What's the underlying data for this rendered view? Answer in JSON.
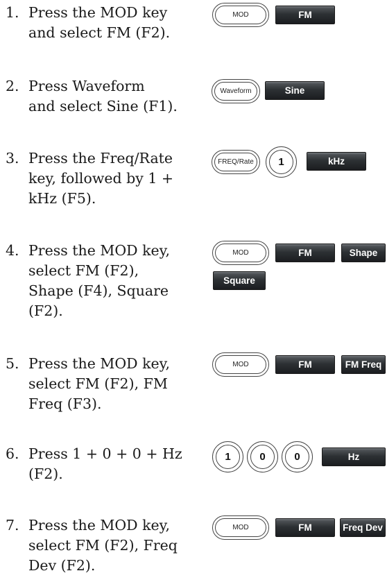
{
  "steps": [
    {
      "num": "1.",
      "text": "Press the MOD key\nand select FM (F2).",
      "keys": [
        {
          "type": "oval",
          "label": "MOD"
        },
        {
          "type": "soft",
          "label": "FM"
        }
      ]
    },
    {
      "num": "2.",
      "text": "Press Waveform\nand select Sine (F1).",
      "keys": [
        {
          "type": "oval",
          "label": "Waveform"
        },
        {
          "type": "soft",
          "label": "Sine"
        }
      ]
    },
    {
      "num": "3.",
      "text": "Press the Freq/Rate\nkey, followed by 1 +\nkHz (F5).",
      "keys": [
        {
          "type": "oval",
          "label": "FREQ/Rate"
        },
        {
          "type": "round",
          "label": "1"
        },
        {
          "type": "soft",
          "label": "kHz"
        }
      ]
    },
    {
      "num": "4.",
      "text": "Press the MOD key,\nselect FM (F2),\nShape (F4), Square\n(F2).",
      "keys": [
        {
          "type": "oval",
          "label": "MOD"
        },
        {
          "type": "soft",
          "label": "FM"
        },
        {
          "type": "soft",
          "label": "Shape"
        },
        {
          "type": "soft",
          "label": "Square"
        }
      ]
    },
    {
      "num": "5.",
      "text": "Press the MOD key,\nselect FM (F2), FM\nFreq (F3).",
      "keys": [
        {
          "type": "oval",
          "label": "MOD"
        },
        {
          "type": "soft",
          "label": "FM"
        },
        {
          "type": "soft",
          "label": "FM Freq"
        }
      ]
    },
    {
      "num": "6.",
      "text": "Press 1 + 0 + 0 + Hz\n(F2).",
      "keys": [
        {
          "type": "round",
          "label": "1"
        },
        {
          "type": "round",
          "label": "0"
        },
        {
          "type": "round",
          "label": "0"
        },
        {
          "type": "soft",
          "label": "Hz"
        }
      ]
    },
    {
      "num": "7.",
      "text": "Press the MOD key,\nselect FM (F2), Freq\nDev (F2).",
      "keys": [
        {
          "type": "oval",
          "label": "MOD"
        },
        {
          "type": "soft",
          "label": "FM"
        },
        {
          "type": "soft",
          "label": "Freq Dev"
        }
      ]
    }
  ]
}
